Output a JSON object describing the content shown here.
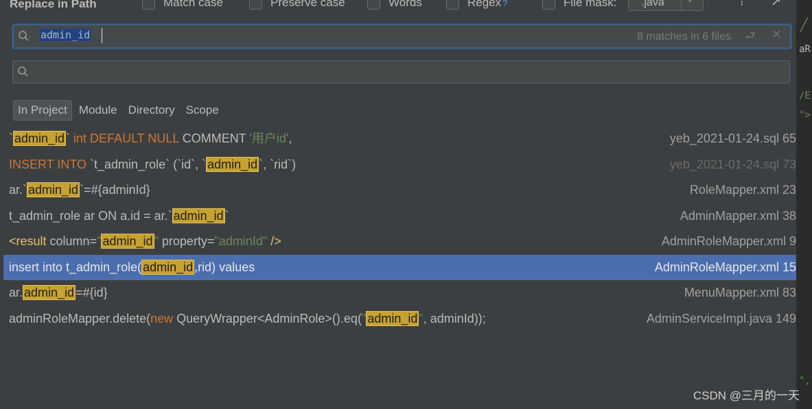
{
  "dialog": {
    "title": "Replace in Path",
    "options": [
      {
        "label": "Match case"
      },
      {
        "label": "Preserve case"
      },
      {
        "label": "Words"
      },
      {
        "label": "Regex"
      },
      {
        "label": "File mask:"
      }
    ],
    "regex_help": "?",
    "file_mask_value": ".java"
  },
  "search": {
    "query": "admin_id",
    "match_summary": "8 matches in 6 files"
  },
  "scopes": [
    "In Project",
    "Module",
    "Directory",
    "Scope"
  ],
  "results": [
    {
      "file": "yeb_2021-01-24.sql 65"
    },
    {
      "file": "yeb_2021-01-24.sql 73"
    },
    {
      "file": "RoleMapper.xml 23"
    },
    {
      "file": "AdminMapper.xml 38"
    },
    {
      "file": "AdminRoleMapper.xml 9"
    },
    {
      "file": "AdminRoleMapper.xml 15"
    },
    {
      "file": "MenuMapper.xml 83"
    },
    {
      "file": "AdminServiceImpl.java 149"
    }
  ],
  "code": {
    "r0": [
      "`",
      "admin_id",
      "` ",
      "int DEFAULT NULL",
      " COMMENT ",
      "'用户id'",
      ","
    ],
    "r1": [
      "INSERT INTO",
      " `t_admin_role` (`id`, `",
      "admin_id",
      "`, `rid`)"
    ],
    "r2": [
      "ar.`",
      "admin_id",
      "`=#{adminId}"
    ],
    "r3": [
      "t_admin_role ar ON a.id = ar.`",
      "admin_id",
      "`"
    ],
    "r4": [
      "<result",
      " column=",
      "\"",
      "admin_id",
      "\"",
      " property=",
      "\"adminId\"",
      " />"
    ],
    "r5": [
      "insert into t_admin_role(",
      "admin_id",
      ",rid) values"
    ],
    "r6": [
      "ar.",
      "admin_id",
      "=#{id}"
    ],
    "r7": [
      "adminRoleMapper.delete(",
      "new",
      " QueryWrapper<AdminRole>().eq(",
      "\"",
      "admin_id",
      "\"",
      ", adminId));"
    ]
  },
  "side_strip": [
    "aR",
    "/E",
    "\">",
    "\","
  ],
  "watermark": "CSDN @三月的一天",
  "colors": {
    "selection": "#4b6eaf",
    "highlight": "#c8a230",
    "keyword": "#cc7832",
    "string": "#6a8759"
  }
}
